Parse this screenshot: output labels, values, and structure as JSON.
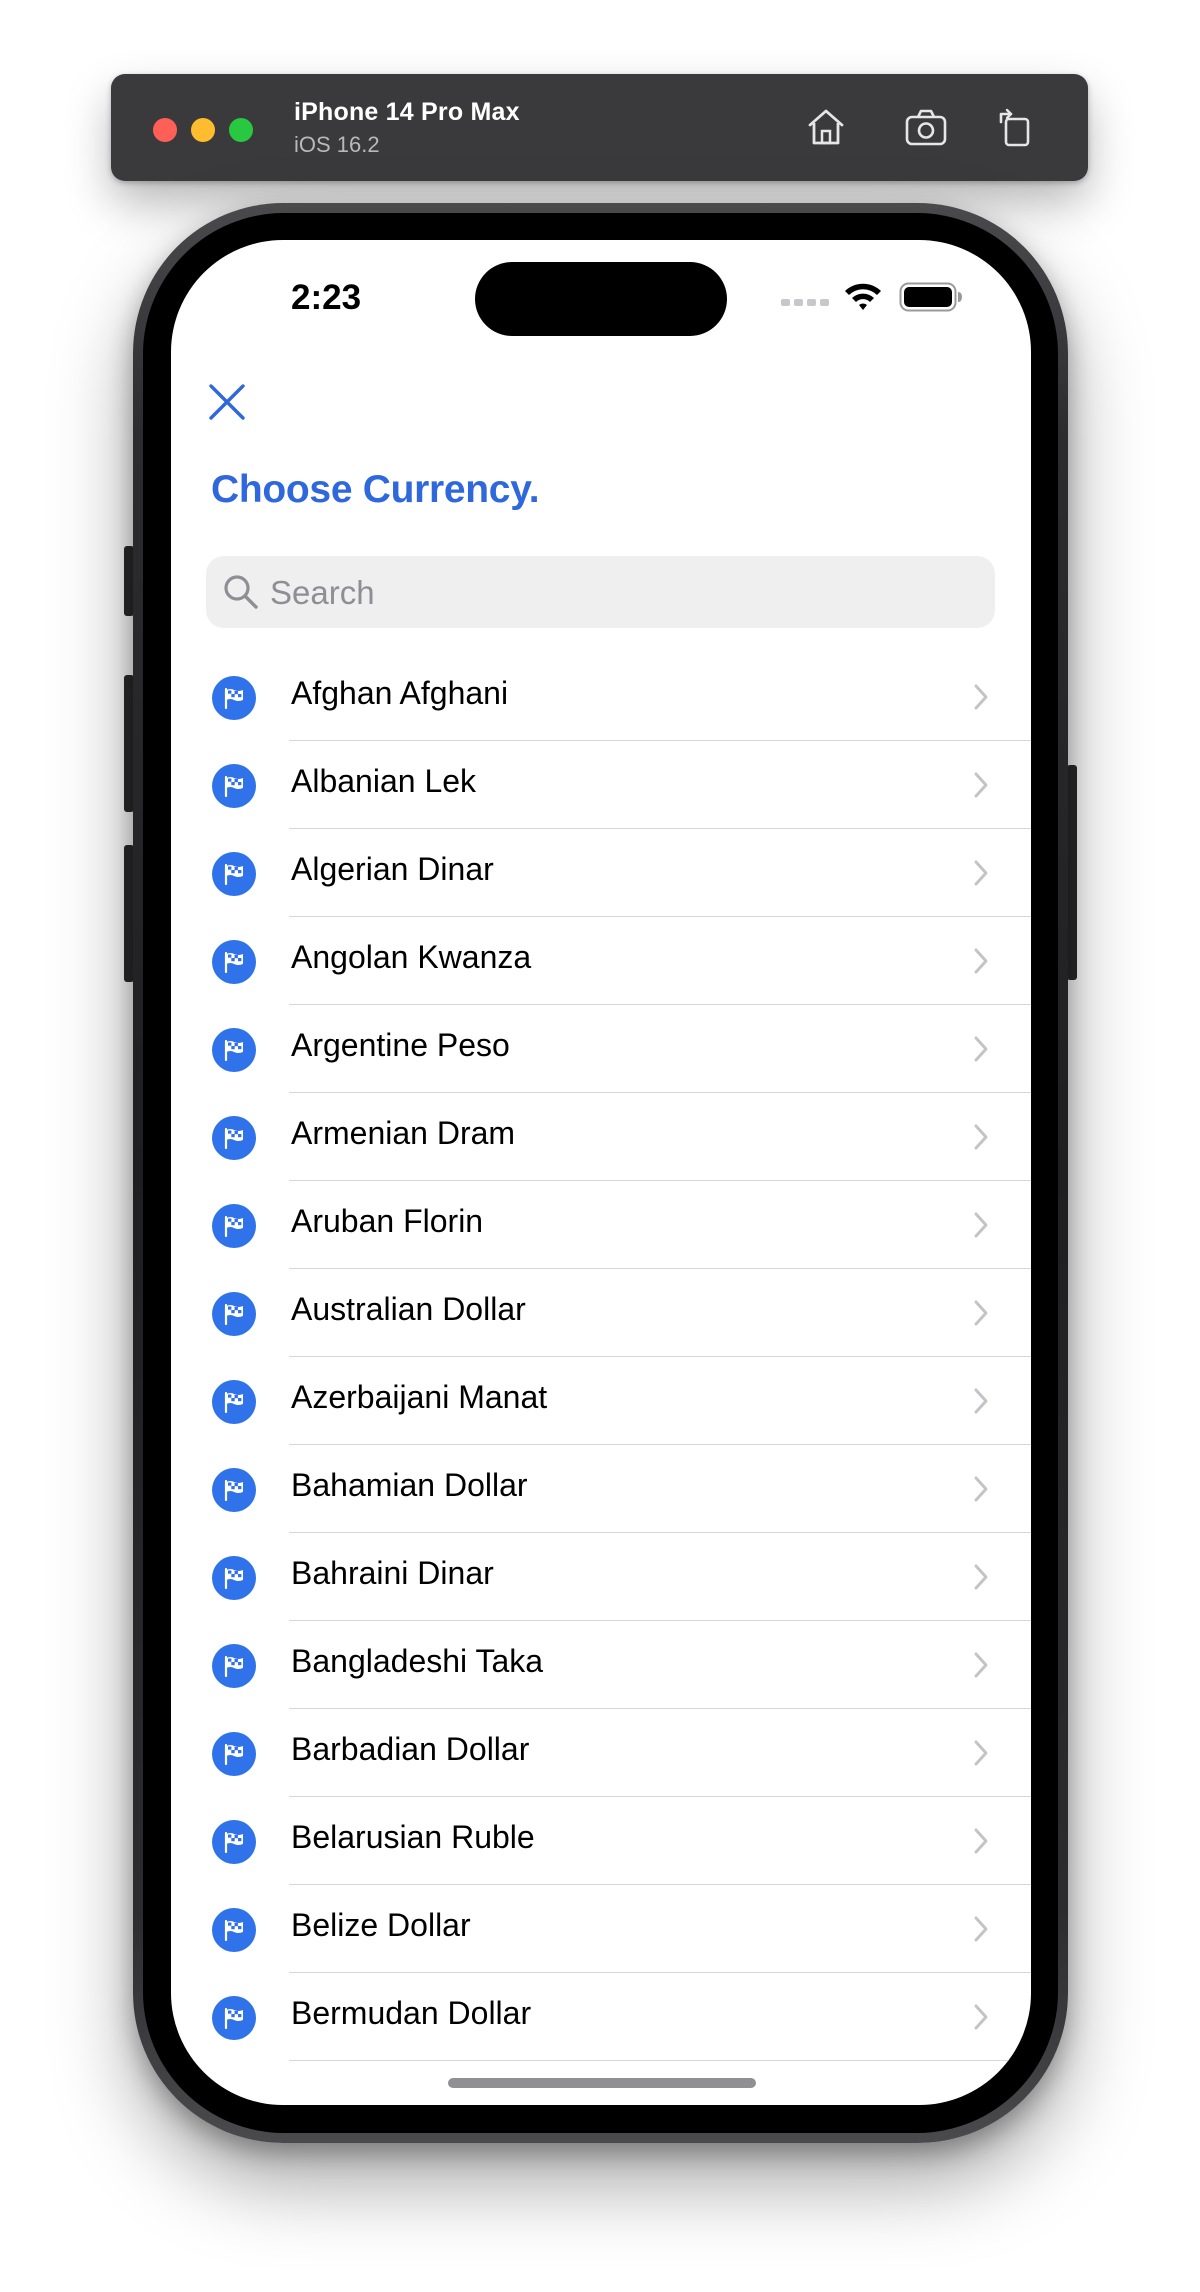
{
  "simulator": {
    "device_name": "iPhone 14 Pro Max",
    "os_version": "iOS 16.2",
    "toolbar_icons": [
      "home-icon",
      "screenshot-icon",
      "rotate-icon"
    ]
  },
  "status_bar": {
    "time": "2:23",
    "icons": [
      "cellular-icon",
      "wifi-icon",
      "battery-icon"
    ]
  },
  "header": {
    "close_icon": "close-icon",
    "title": "Choose Currency."
  },
  "search": {
    "placeholder": "Search",
    "value": ""
  },
  "colors": {
    "accent": "#2f67dd",
    "icon_bg": "#2f72ea"
  },
  "currencies": [
    {
      "label": "Afghan Afghani",
      "icon": "checkered-flag-icon"
    },
    {
      "label": "Albanian Lek",
      "icon": "checkered-flag-icon"
    },
    {
      "label": "Algerian Dinar",
      "icon": "checkered-flag-icon"
    },
    {
      "label": "Angolan Kwanza",
      "icon": "checkered-flag-icon"
    },
    {
      "label": "Argentine Peso",
      "icon": "checkered-flag-icon"
    },
    {
      "label": "Armenian Dram",
      "icon": "checkered-flag-icon"
    },
    {
      "label": "Aruban Florin",
      "icon": "checkered-flag-icon"
    },
    {
      "label": "Australian Dollar",
      "icon": "checkered-flag-icon"
    },
    {
      "label": "Azerbaijani Manat",
      "icon": "checkered-flag-icon"
    },
    {
      "label": "Bahamian Dollar",
      "icon": "checkered-flag-icon"
    },
    {
      "label": "Bahraini Dinar",
      "icon": "checkered-flag-icon"
    },
    {
      "label": "Bangladeshi Taka",
      "icon": "checkered-flag-icon"
    },
    {
      "label": "Barbadian Dollar",
      "icon": "checkered-flag-icon"
    },
    {
      "label": "Belarusian Ruble",
      "icon": "checkered-flag-icon"
    },
    {
      "label": "Belize Dollar",
      "icon": "checkered-flag-icon"
    },
    {
      "label": "Bermudan Dollar",
      "icon": "checkered-flag-icon"
    }
  ]
}
